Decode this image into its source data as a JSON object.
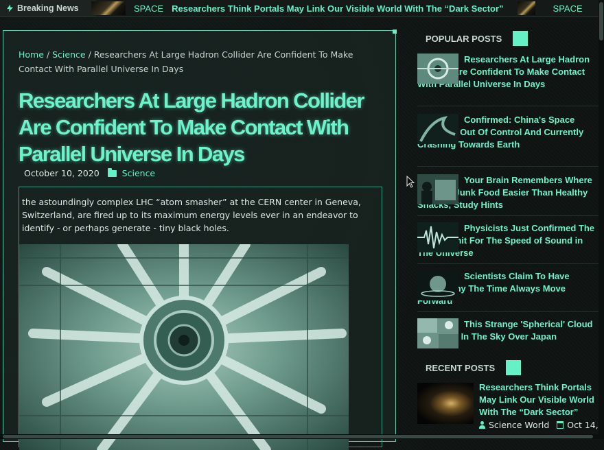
{
  "ticker": {
    "label": "Breaking News",
    "category_1": "SPACE",
    "headline_1": "Researchers Think Portals May Link Our Visible World With The “Dark Sector”",
    "category_2": "SPACE"
  },
  "breadcrumb": {
    "home": "Home",
    "sep1": "/",
    "section": "Science",
    "sep2": "/",
    "current": "Researchers At Large Hadron Collider Are Confident To Make Contact With Parallel Universe In Days"
  },
  "article": {
    "title": "Researchers At Large Hadron Collider Are Confident To Make Contact With Parallel Universe In Days",
    "date": "October 10, 2020",
    "category": "Science",
    "excerpt": " the astoundingly complex LHC “atom smasher” at the CERN center in Geneva, Switzerland, are fired up to its maximum energy levels ever in an endeavor to identify - or perhaps generate - tiny black holes."
  },
  "sidebar": {
    "popular_heading": "POPULAR POSTS",
    "popular": [
      {
        "title": "Researchers At Large Hadron Collider Are Confident To Make Contact With Parallel Universe In Days"
      },
      {
        "title": "Confirmed: China's Space Station Is Out Of Control And Currently Crashing Towards Earth"
      },
      {
        "title": "Your Brain Remembers Where You Left Junk Food Easier Than Healthy Snacks, Study Hints"
      },
      {
        "title": "Physicists Just Confirmed The Upper Limit For The Speed of Sound in The Universe"
      },
      {
        "title": "Scientists Claim To Have Found Why The Time Always Move Forward"
      },
      {
        "title": "This Strange 'Spherical' Cloud Appeared In The Sky Over Japan"
      }
    ],
    "recent_heading": "RECENT POSTS",
    "recent": [
      {
        "title": "Researchers Think Portals May Link Our Visible World With The “Dark Sector”",
        "author": "Science World",
        "date": "Oct 14,"
      }
    ]
  },
  "colors": {
    "accent": "#66f0c6",
    "background": "#0f1413",
    "card": "#182421"
  }
}
